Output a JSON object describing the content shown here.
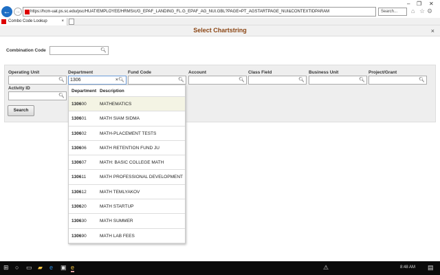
{
  "browser": {
    "url": "https://hcm-uat.ps.sc.edu/psc/HUAT/EMPLOYEE/HRMS/c/G_EPAF_LANDING_FL.G_EPAF_AG_NUI.GBL?PAGE=PT_AGSTARTPAGE_NUI&CONTEXTIDPARAM",
    "search_placeholder": "Search...",
    "tab_title": "Combo Code Lookup"
  },
  "dialog": {
    "title": "Select Chartstring",
    "close": "×"
  },
  "combination": {
    "label": "Combination Code",
    "value": ""
  },
  "fields": [
    {
      "label": "Operating Unit",
      "value": ""
    },
    {
      "label": "Department",
      "value": "1306"
    },
    {
      "label": "Fund Code",
      "value": ""
    },
    {
      "label": "Account",
      "value": ""
    },
    {
      "label": "Class Field",
      "value": ""
    },
    {
      "label": "Business Unit",
      "value": ""
    },
    {
      "label": "Project/Grant",
      "value": ""
    },
    {
      "label": "Activity ID",
      "value": ""
    }
  ],
  "search_button": "Search",
  "dropdown": {
    "headers": [
      "Department",
      "Description"
    ],
    "rows": [
      [
        "130600",
        "MATHEMATICS"
      ],
      [
        "130601",
        "MATH SIAM SIDMA"
      ],
      [
        "130602",
        "MATH-PLACEMENT TESTS"
      ],
      [
        "130606",
        "MATH RETENTION FUND JU"
      ],
      [
        "130607",
        "MATH: BASIC COLLEGE MATH"
      ],
      [
        "130611",
        "MATH PROFESSIONAL DEVELOPMENT"
      ],
      [
        "130612",
        "MATH TEMLYAKOV"
      ],
      [
        "130620",
        "MATH STARTUP"
      ],
      [
        "130630",
        "MATH SUMMER"
      ],
      [
        "130690",
        "MATH LAB FEES"
      ]
    ]
  },
  "taskbar": {
    "time": "8:48 AM"
  },
  "colors": {
    "title": "#8b4513",
    "highlight_row": "#f4f4e4"
  }
}
